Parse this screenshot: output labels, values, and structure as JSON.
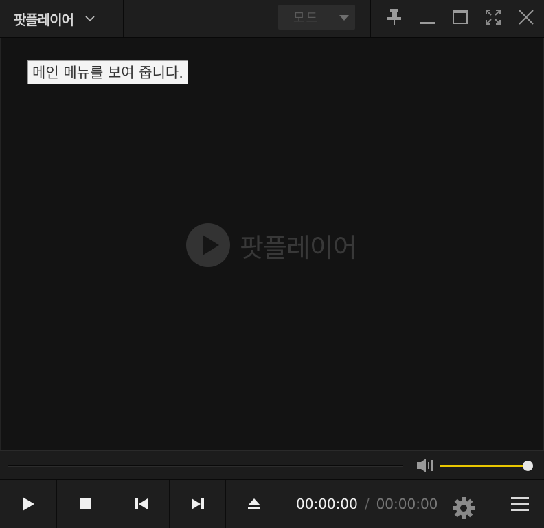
{
  "titlebar": {
    "app_menu_label": "팟플레이어",
    "mode_label": "모드"
  },
  "tooltip": {
    "text": "메인 메뉴를 보여 줍니다."
  },
  "video": {
    "logo_text": "팟플레이어"
  },
  "playback": {
    "current_time": "00:00:00",
    "separator": "/",
    "total_time": "00:00:00",
    "seek_progress": 0,
    "volume_level": 1.0
  },
  "colors": {
    "volume_accent": "#e8c600",
    "background": "#131313",
    "bar": "#1e1e1e"
  },
  "icons": [
    "chevron-down-icon",
    "dropdown-triangle-icon",
    "pin-icon",
    "minimize-icon",
    "maximize-icon",
    "fullscreen-icon",
    "close-icon",
    "play-logo-icon",
    "speaker-icon",
    "play-icon",
    "stop-icon",
    "previous-icon",
    "next-icon",
    "eject-icon",
    "gear-icon",
    "hamburger-icon"
  ]
}
